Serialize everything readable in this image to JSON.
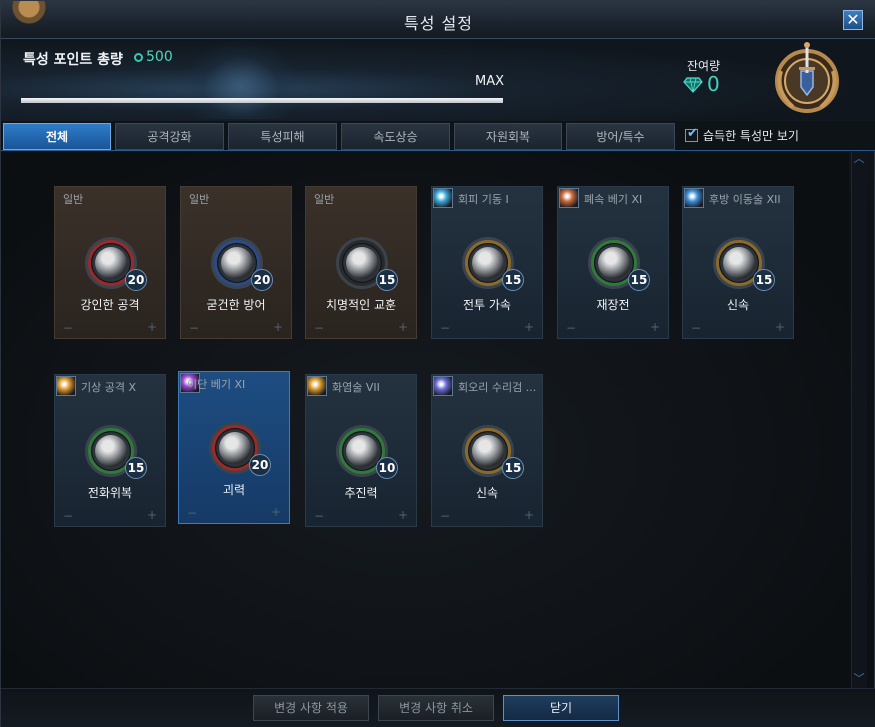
{
  "window": {
    "title": "특성 설정",
    "close_label": "✕"
  },
  "header": {
    "points_label": "특성 포인트 총량",
    "points_value": "500",
    "max_label": "MAX",
    "bar_fill_fraction": 1.0,
    "remaining_label": "잔여량",
    "remaining_value": "0"
  },
  "tabs": [
    {
      "label": "전체",
      "active": true
    },
    {
      "label": "공격강화",
      "active": false
    },
    {
      "label": "특성피해",
      "active": false
    },
    {
      "label": "속도상승",
      "active": false
    },
    {
      "label": "자원회복",
      "active": false
    },
    {
      "label": "방어/특수",
      "active": false
    }
  ],
  "filter": {
    "label": "습득한 특성만 보기",
    "checked": true
  },
  "cards": [
    {
      "category": "일반",
      "name": "강인한 공격",
      "level": "20",
      "type": "general",
      "ring": "#9a2a2a",
      "icon": "flexed-arm-icon"
    },
    {
      "category": "일반",
      "name": "굳건한 방어",
      "level": "20",
      "type": "general",
      "ring": "#2c4b86",
      "icon": "fist-icon"
    },
    {
      "category": "일반",
      "name": "치명적인 교훈",
      "level": "15",
      "type": "general",
      "ring": "#2a2a2a",
      "icon": "pointing-hand-icon"
    },
    {
      "category": "회피 기동 I",
      "name": "전투 가속",
      "level": "15",
      "type": "skill",
      "ring": "#8a6a2a",
      "icon": "boots-icon",
      "skill_color": "#3aa8d8"
    },
    {
      "category": "폐속 베기 XI",
      "name": "재장전",
      "level": "15",
      "type": "skill",
      "ring": "#2f7a3a",
      "icon": "rune-circle-icon",
      "skill_color": "#c86a3a"
    },
    {
      "category": "후방 이동술 XII",
      "name": "신속",
      "level": "15",
      "type": "skill",
      "ring": "#8a6a2a",
      "icon": "wind-swirl-icon",
      "skill_color": "#3a8fd8"
    },
    {
      "category": "기상 공격 X",
      "name": "전화위복",
      "level": "15",
      "type": "skill",
      "ring": "#2f7a3a",
      "icon": "rune-circle-icon",
      "skill_color": "#e09a2a"
    },
    {
      "category": "이단 베기 XI",
      "name": "괴력",
      "level": "20",
      "type": "selected",
      "ring": "#9a2a2a",
      "icon": "flexed-arm-icon",
      "skill_color": "#9a4ad8"
    },
    {
      "category": "화염술 VII",
      "name": "추진력",
      "level": "10",
      "type": "skill",
      "ring": "#2f7a3a",
      "icon": "rune-circle-icon",
      "skill_color": "#d89a2a"
    },
    {
      "category": "회오리 수리검 ...",
      "name": "신속",
      "level": "15",
      "type": "skill",
      "ring": "#8a6a2a",
      "icon": "wind-swirl-icon",
      "skill_color": "#6a6ad8"
    }
  ],
  "footer": {
    "apply_label": "변경 사항 적용",
    "cancel_label": "변경 사항 취소",
    "close_label": "닫기"
  },
  "icons": {
    "gem": "gem-icon",
    "badge": "sword-laurel-badge-icon",
    "corner": "corner-emblem-icon"
  }
}
